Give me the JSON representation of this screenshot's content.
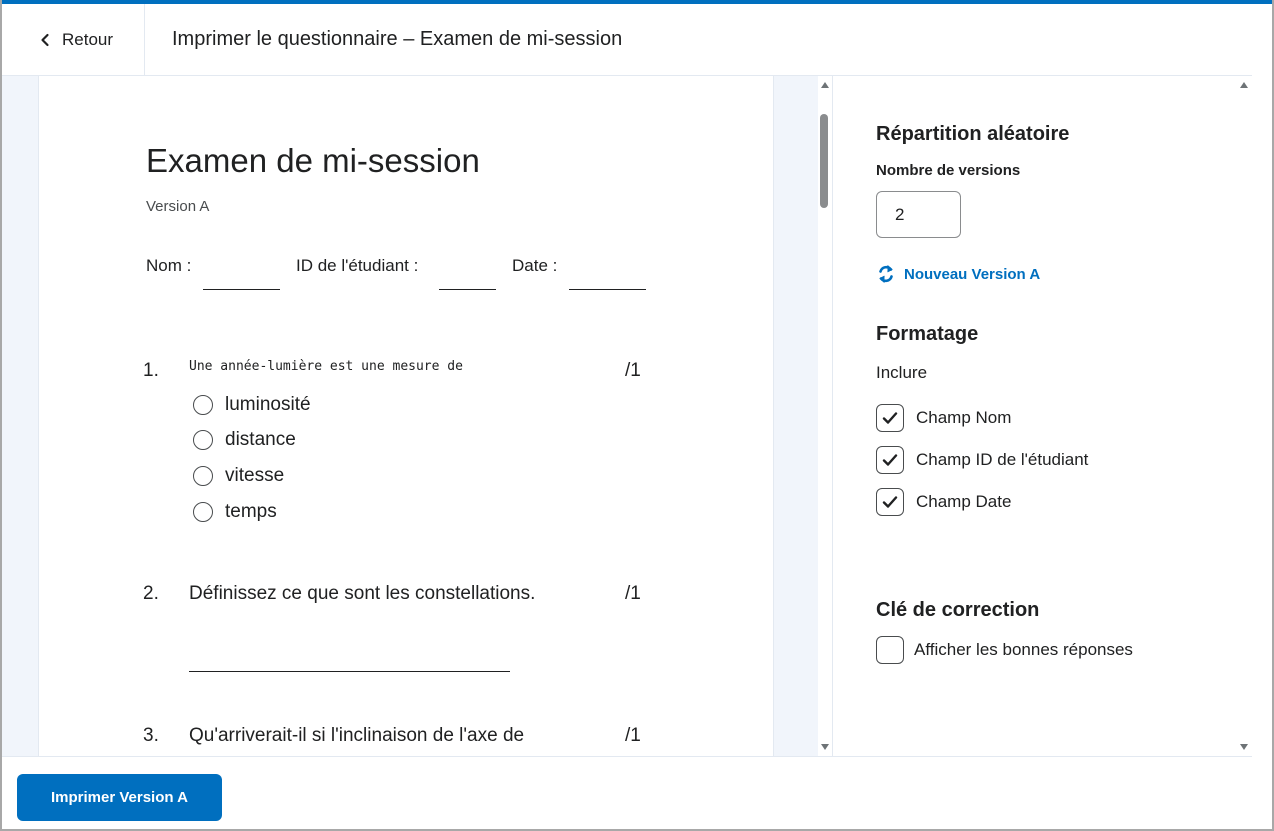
{
  "header": {
    "back_label": "Retour",
    "title": "Imprimer le questionnaire – Examen de mi-session"
  },
  "preview": {
    "exam_title": "Examen de mi-session",
    "version": "Version A",
    "fields": {
      "name_label": "Nom :",
      "student_id_label": "ID de l'étudiant :",
      "date_label": "Date :"
    },
    "questions": [
      {
        "number": "1.",
        "text": "Une année-lumière est une mesure de",
        "points": "/1",
        "options": [
          "luminosité",
          "distance",
          "vitesse",
          "temps"
        ]
      },
      {
        "number": "2.",
        "text": "Définissez ce que sont les constellations.",
        "points": "/1"
      },
      {
        "number": "3.",
        "text": "Qu'arriverait-il si l'inclinaison de l'axe de",
        "points": "/1"
      }
    ]
  },
  "settings": {
    "randomization_heading": "Répartition aléatoire",
    "versions_label": "Nombre de versions",
    "versions_value": "2",
    "new_version_label": "Nouveau Version A",
    "formatting_heading": "Formatage",
    "include_label": "Inclure",
    "include_options": [
      {
        "label": "Champ Nom",
        "checked": true
      },
      {
        "label": "Champ ID de l'étudiant",
        "checked": true
      },
      {
        "label": "Champ Date",
        "checked": true
      }
    ],
    "answer_key_heading": "Clé de correction",
    "show_answers_label": "Afficher les bonnes réponses",
    "show_answers_checked": false
  },
  "footer": {
    "print_button_label": "Imprimer Version A"
  },
  "colors": {
    "accent": "#006fbf",
    "preview_background": "#f1f5fb",
    "border": "#e3e9f1"
  }
}
